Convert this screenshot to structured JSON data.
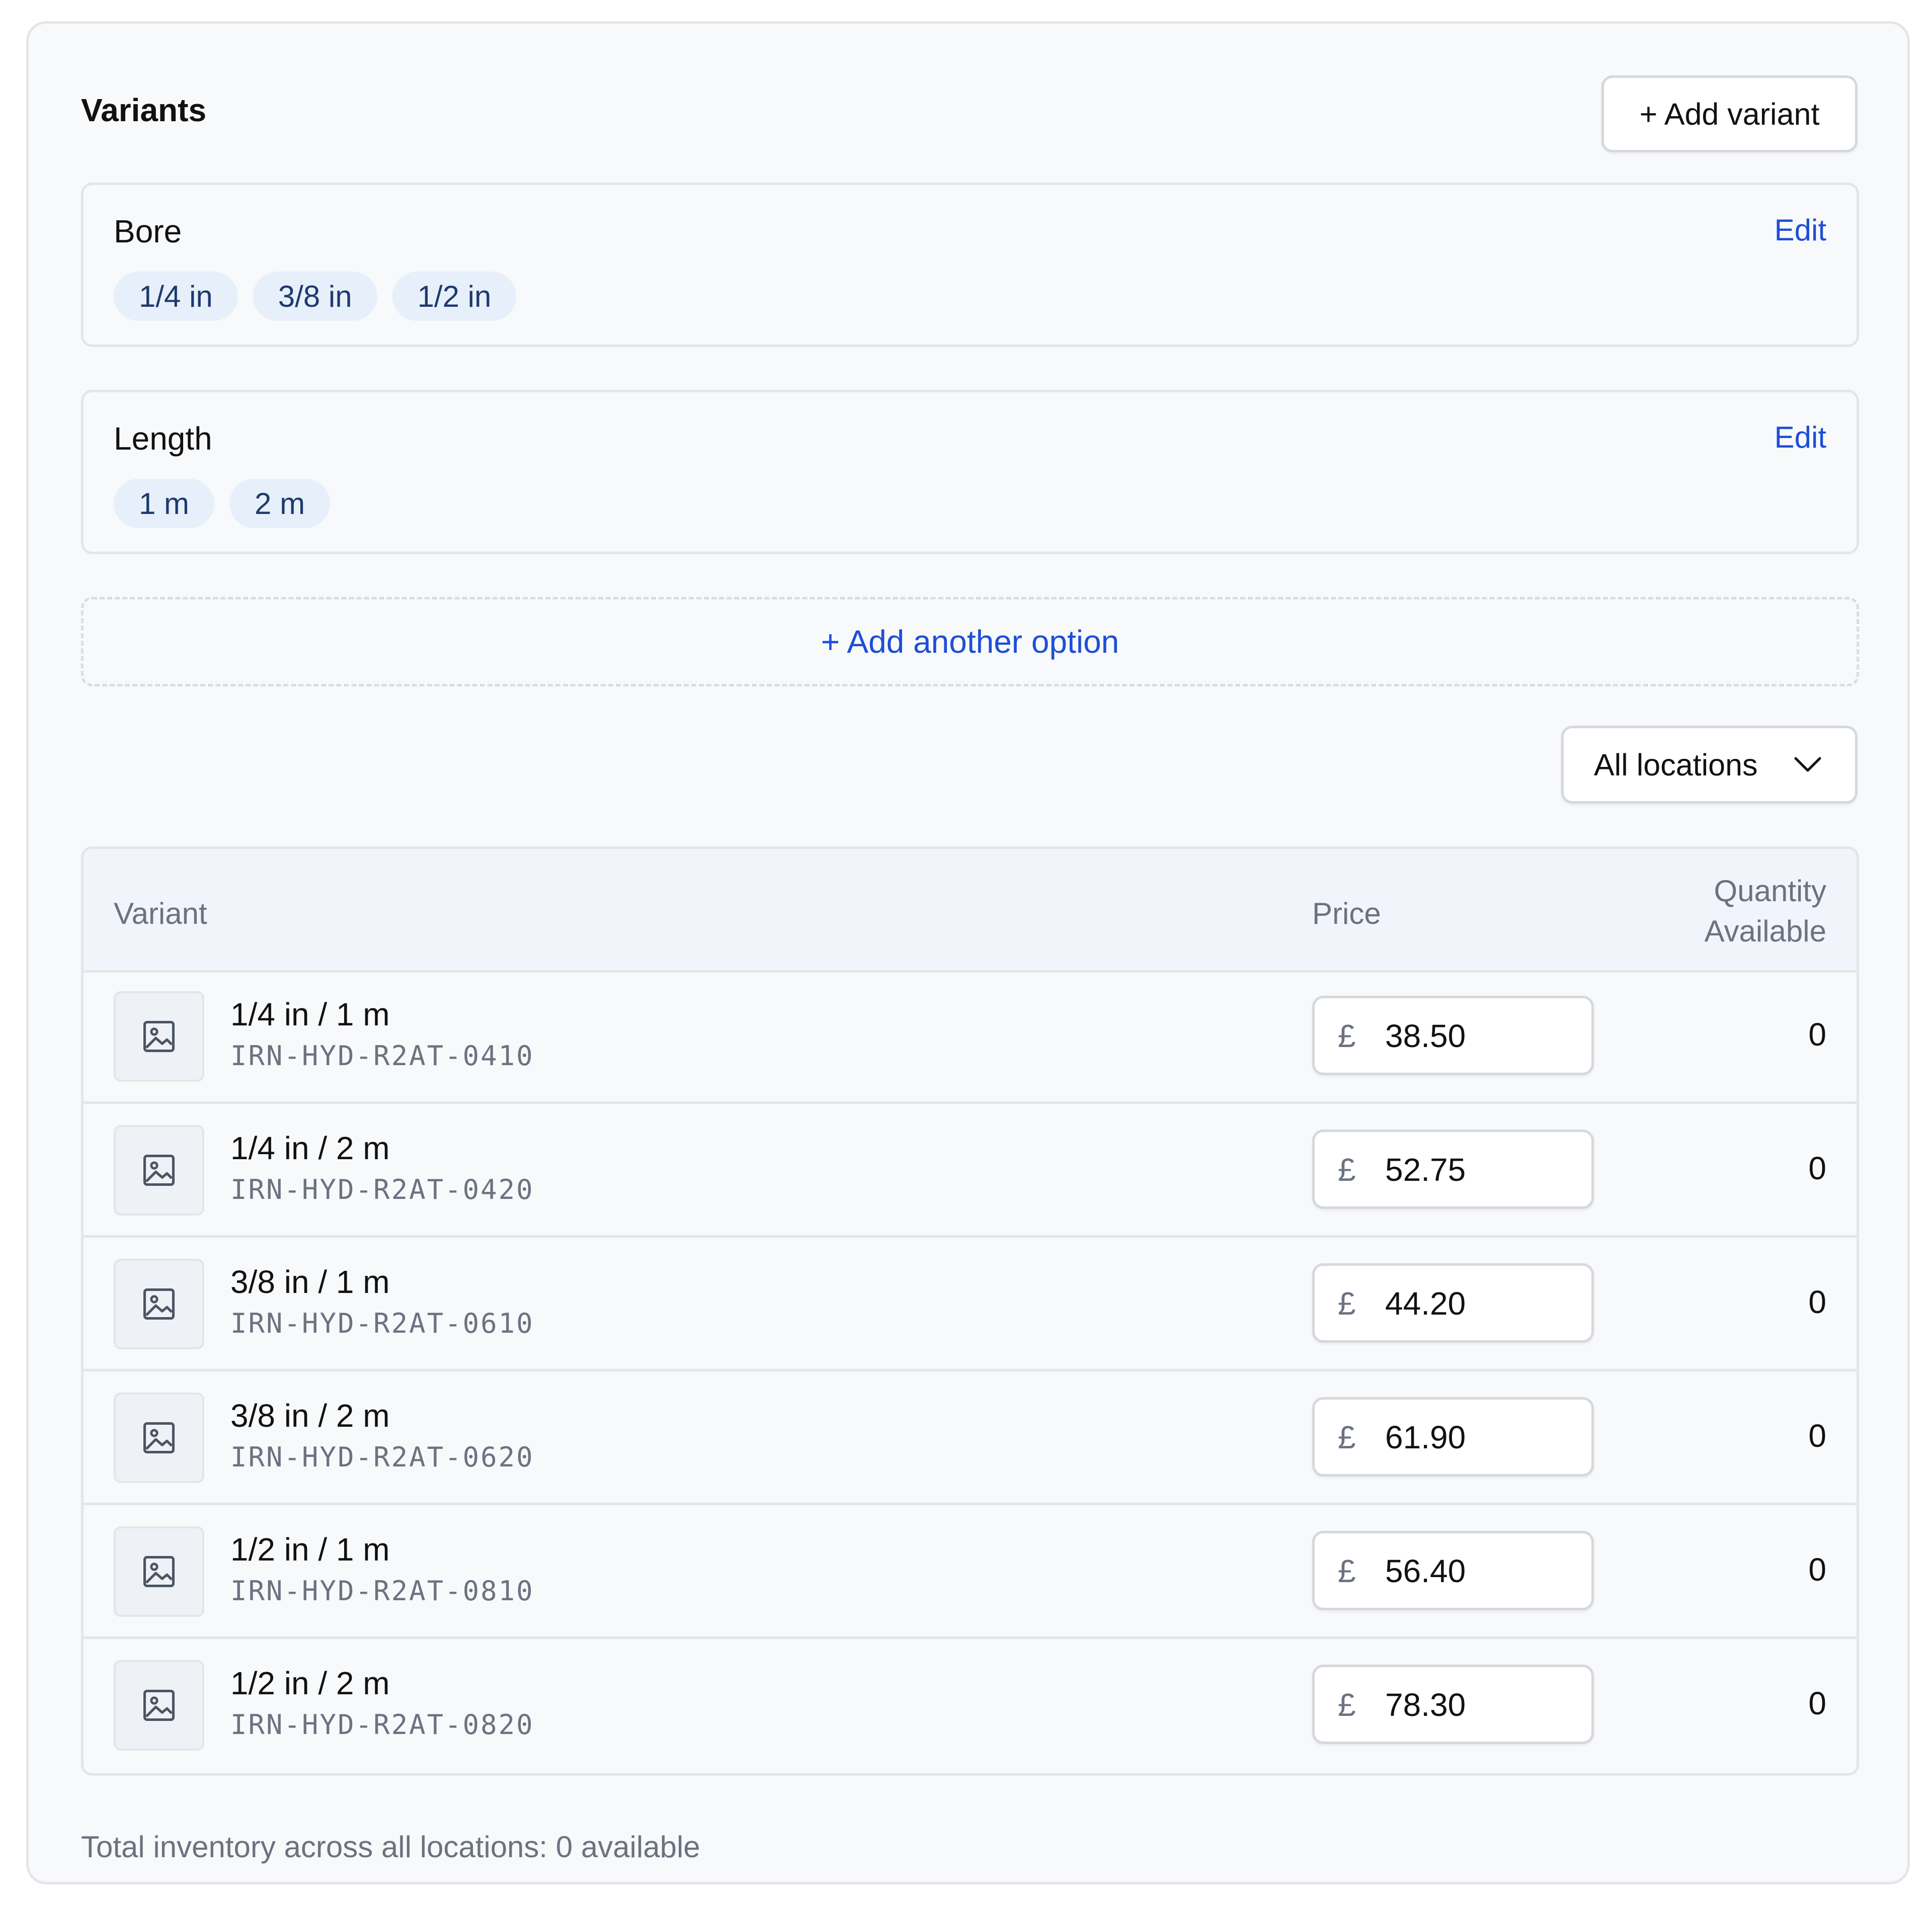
{
  "section": {
    "title": "Variants",
    "add_variant_label": "+ Add variant"
  },
  "options": [
    {
      "name": "Bore",
      "edit_label": "Edit",
      "values": [
        "1/4 in",
        "3/8 in",
        "1/2 in"
      ]
    },
    {
      "name": "Length",
      "edit_label": "Edit",
      "values": [
        "1 m",
        "2 m"
      ]
    }
  ],
  "add_option_label": "+ Add another option",
  "locations_select": {
    "selected": "All locations",
    "icon": "chevron-down-icon"
  },
  "table": {
    "headers": {
      "variant": "Variant",
      "price": "Price",
      "quantity_line1": "Quantity",
      "quantity_line2": "Available"
    },
    "rows": [
      {
        "title": "1/4 in / 1 m",
        "sku": "IRN-HYD-R2AT-0410",
        "currency": "£",
        "price": "38.50",
        "quantity": "0"
      },
      {
        "title": "1/4 in / 2 m",
        "sku": "IRN-HYD-R2AT-0420",
        "currency": "£",
        "price": "52.75",
        "quantity": "0"
      },
      {
        "title": "3/8 in / 1 m",
        "sku": "IRN-HYD-R2AT-0610",
        "currency": "£",
        "price": "44.20",
        "quantity": "0"
      },
      {
        "title": "3/8 in / 2 m",
        "sku": "IRN-HYD-R2AT-0620",
        "currency": "£",
        "price": "61.90",
        "quantity": "0"
      },
      {
        "title": "1/2 in / 1 m",
        "sku": "IRN-HYD-R2AT-0810",
        "currency": "£",
        "price": "56.40",
        "quantity": "0"
      },
      {
        "title": "1/2 in / 2 m",
        "sku": "IRN-HYD-R2AT-0820",
        "currency": "£",
        "price": "78.30",
        "quantity": "0"
      }
    ]
  },
  "footer_note": "Total inventory across all locations: 0 available",
  "colors": {
    "accent": "#1d4ed8",
    "chip_bg": "#e7effa",
    "chip_text": "#1e3a6e",
    "muted_text": "#6b7280",
    "border": "#e3e5e9"
  }
}
